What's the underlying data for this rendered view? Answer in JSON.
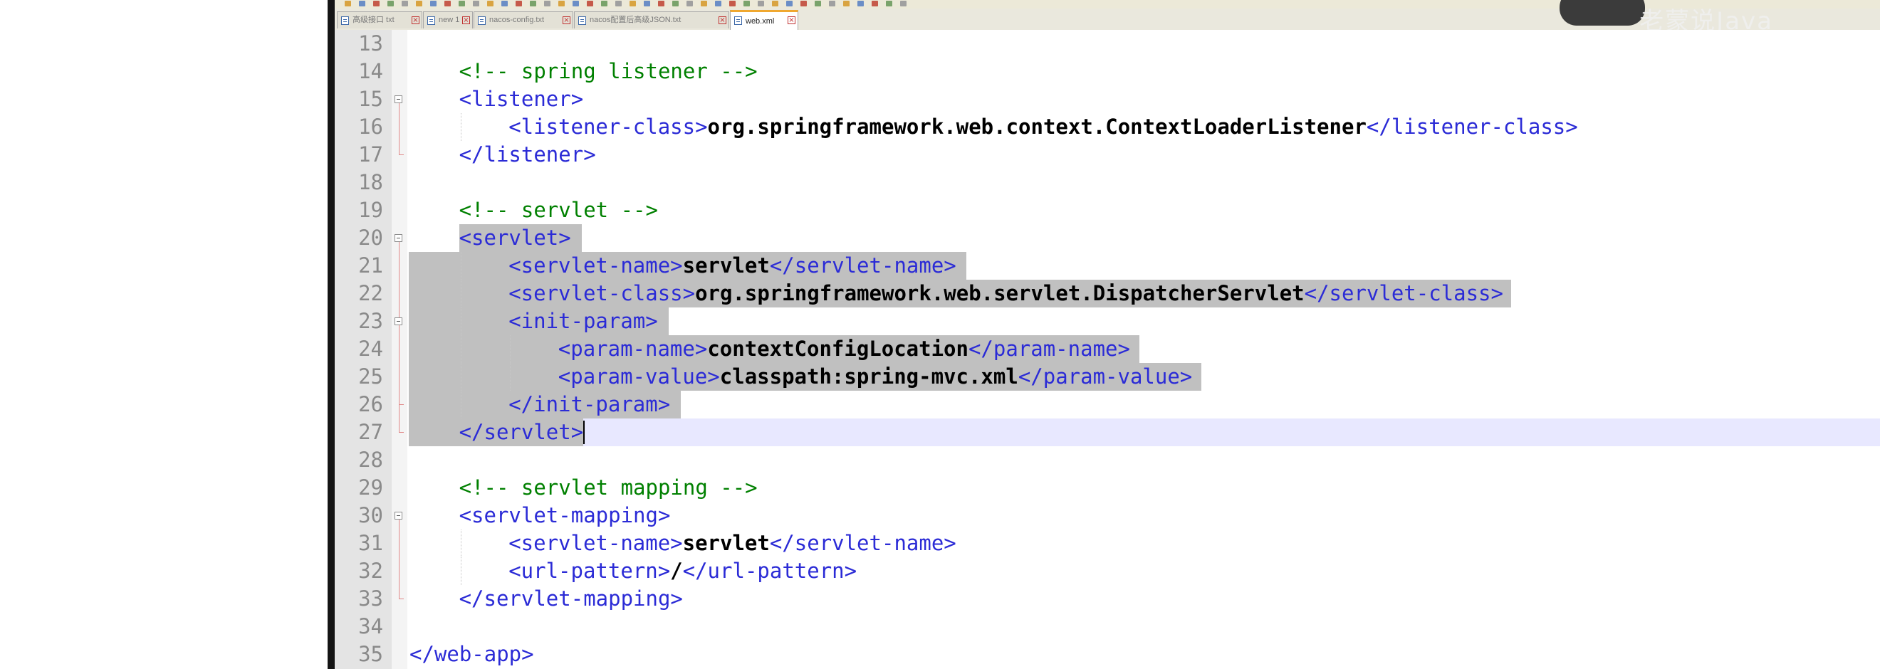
{
  "tabs": [
    {
      "label": "高级接口 txt",
      "active": false
    },
    {
      "label": "new 1",
      "active": false
    },
    {
      "label": "nacos-config.txt",
      "active": false
    },
    {
      "label": "nacos配置后高级JSON.txt",
      "active": false
    },
    {
      "label": "web.xml",
      "active": true
    }
  ],
  "watermark": "老蒙说Java",
  "editor": {
    "lines": [
      {
        "n": "13",
        "text": ""
      },
      {
        "n": "14",
        "comment": "<!-- spring listener -->"
      },
      {
        "n": "15",
        "open": "<listener>"
      },
      {
        "n": "16",
        "open": "<listener-class>",
        "text": "org.springframework.web.context.ContextLoaderListener",
        "close": "</listener-class>"
      },
      {
        "n": "17",
        "close": "</listener>"
      },
      {
        "n": "18",
        "text": ""
      },
      {
        "n": "19",
        "comment": "<!-- servlet -->"
      },
      {
        "n": "20",
        "open": "<servlet>"
      },
      {
        "n": "21",
        "open": "<servlet-name>",
        "text": "servlet",
        "close": "</servlet-name>"
      },
      {
        "n": "22",
        "open": "<servlet-class>",
        "text": "org.springframework.web.servlet.DispatcherServlet",
        "close": "</servlet-class>"
      },
      {
        "n": "23",
        "open": "<init-param>"
      },
      {
        "n": "24",
        "open": "<param-name>",
        "text": "contextConfigLocation",
        "close": "</param-name>"
      },
      {
        "n": "25",
        "open": "<param-value>",
        "text": "classpath:spring-mvc.xml",
        "close": "</param-value>"
      },
      {
        "n": "26",
        "close": "</init-param>"
      },
      {
        "n": "27",
        "close": "</servlet>"
      },
      {
        "n": "28",
        "text": ""
      },
      {
        "n": "29",
        "comment": "<!-- servlet mapping -->"
      },
      {
        "n": "30",
        "open": "<servlet-mapping>"
      },
      {
        "n": "31",
        "open": "<servlet-name>",
        "text": "servlet",
        "close": "</servlet-name>"
      },
      {
        "n": "32",
        "open": "<url-pattern>",
        "text": "/",
        "close": "</url-pattern>"
      },
      {
        "n": "33",
        "close": "</servlet-mapping>"
      },
      {
        "n": "34",
        "text": ""
      },
      {
        "n": "35",
        "close": "</web-app>"
      }
    ]
  },
  "colors": {
    "tag": "#2b2bd6",
    "comment": "#008000",
    "text": "#000000",
    "selection": "#c0c0c0",
    "current_line": "#e8e8ff"
  }
}
